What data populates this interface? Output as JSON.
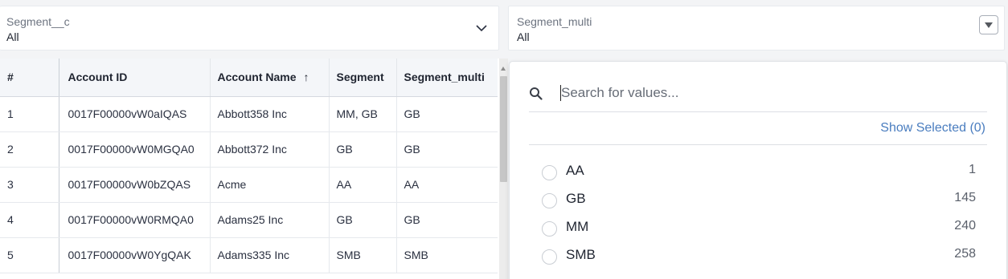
{
  "filters": [
    {
      "label": "Segment__c",
      "value": "All",
      "icon": "chevron-down-icon"
    },
    {
      "label": "Segment_multi",
      "value": "All",
      "icon": "dropdown-triangle-icon"
    }
  ],
  "table": {
    "columns": [
      "#",
      "Account ID",
      "Account Name",
      "Segment",
      "Segment_multi"
    ],
    "sort_indicator": "↑",
    "rows": [
      [
        "1",
        "0017F00000vW0aIQAS",
        "Abbott358 Inc",
        "MM, GB",
        "GB"
      ],
      [
        "2",
        "0017F00000vW0MGQA0",
        "Abbott372 Inc",
        "GB",
        "GB"
      ],
      [
        "3",
        "0017F00000vW0bZQAS",
        "Acme",
        "AA",
        "AA"
      ],
      [
        "4",
        "0017F00000vW0RMQA0",
        "Adams25 Inc",
        "GB",
        "GB"
      ],
      [
        "5",
        "0017F00000vW0YgQAK",
        "Adams335 Inc",
        "SMB",
        "SMB"
      ]
    ]
  },
  "popup": {
    "search_placeholder": "Search for values...",
    "show_selected": "Show Selected (0)",
    "options": [
      {
        "label": "AA",
        "count": "1"
      },
      {
        "label": "GB",
        "count": "145"
      },
      {
        "label": "MM",
        "count": "240"
      },
      {
        "label": "SMB",
        "count": "258"
      }
    ]
  },
  "colors": {
    "link": "#4a7dbf",
    "header_bg": "#f4f6f9",
    "page_bg": "#f3f4f6"
  }
}
